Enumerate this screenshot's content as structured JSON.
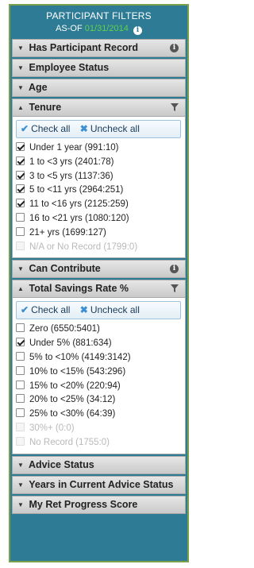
{
  "header": {
    "title": "PARTICIPANT FILTERS",
    "asof_label": "AS-OF",
    "asof_date": "01/31/2014"
  },
  "sections": {
    "has_participant_record": {
      "label": "Has Participant Record"
    },
    "employee_status": {
      "label": "Employee Status"
    },
    "age": {
      "label": "Age"
    },
    "tenure": {
      "label": "Tenure",
      "check_all": "Check all",
      "uncheck_all": "Uncheck all",
      "options": [
        {
          "label": "Under 1 year (991:10)",
          "checked": true,
          "disabled": false
        },
        {
          "label": "1 to <3 yrs (2401:78)",
          "checked": true,
          "disabled": false
        },
        {
          "label": "3 to <5 yrs (1137:36)",
          "checked": true,
          "disabled": false
        },
        {
          "label": "5 to <11 yrs (2964:251)",
          "checked": true,
          "disabled": false
        },
        {
          "label": "11 to <16 yrs (2125:259)",
          "checked": true,
          "disabled": false
        },
        {
          "label": "16 to <21 yrs (1080:120)",
          "checked": false,
          "disabled": false
        },
        {
          "label": "21+ yrs (1699:127)",
          "checked": false,
          "disabled": false
        },
        {
          "label": "N/A or No Record (1799:0)",
          "checked": false,
          "disabled": true
        }
      ]
    },
    "can_contribute": {
      "label": "Can Contribute"
    },
    "total_savings_rate": {
      "label": "Total Savings Rate %",
      "check_all": "Check all",
      "uncheck_all": "Uncheck all",
      "options": [
        {
          "label": "Zero (6550:5401)",
          "checked": false,
          "disabled": false
        },
        {
          "label": "Under 5% (881:634)",
          "checked": true,
          "disabled": false
        },
        {
          "label": "5% to <10% (4149:3142)",
          "checked": false,
          "disabled": false
        },
        {
          "label": "10% to <15% (543:296)",
          "checked": false,
          "disabled": false
        },
        {
          "label": "15% to <20% (220:94)",
          "checked": false,
          "disabled": false
        },
        {
          "label": "20% to <25% (34:12)",
          "checked": false,
          "disabled": false
        },
        {
          "label": "25% to <30% (64:39)",
          "checked": false,
          "disabled": false
        },
        {
          "label": "30%+ (0:0)",
          "checked": false,
          "disabled": true
        },
        {
          "label": "No Record (1755:0)",
          "checked": false,
          "disabled": true
        }
      ]
    },
    "advice_status": {
      "label": "Advice Status"
    },
    "years_in_current_advice_status": {
      "label": "Years in Current Advice Status"
    },
    "my_ret_progress_score": {
      "label": "My Ret Progress Score"
    }
  },
  "colors": {
    "panel_bg": "#2e7b95",
    "frame_border": "#7aa04a",
    "asof_date": "#5fd24a"
  }
}
